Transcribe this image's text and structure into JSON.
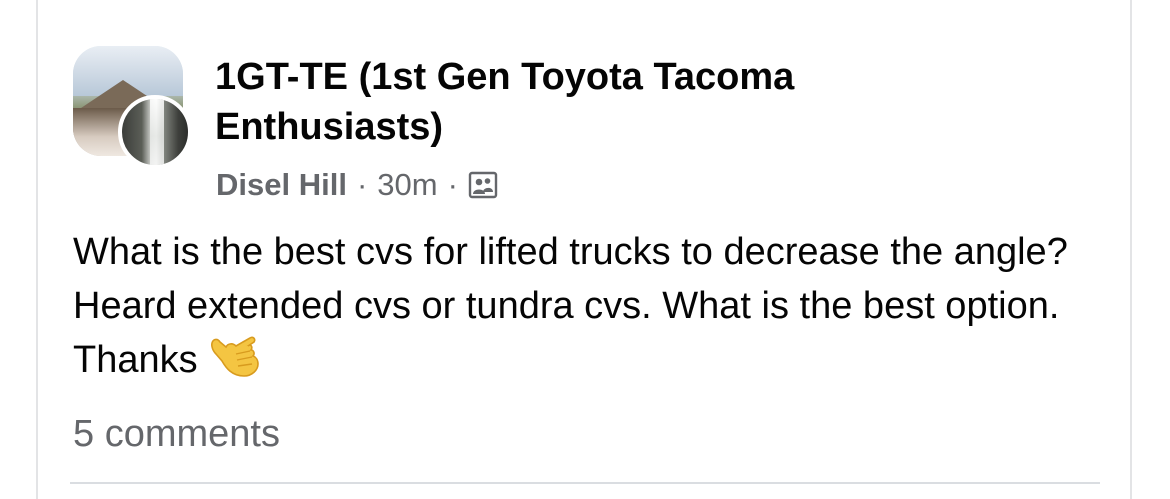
{
  "post": {
    "group_name": "1GT-TE (1st Gen Toyota Tacoma Enthusiasts)",
    "author": "Disel Hill",
    "separator": "·",
    "time": "30m",
    "audience_icon": "members-icon",
    "body": "What is the best cvs for lifted trucks to decrease the angle? Heard extended cvs or tundra cvs. What is the best option. Thanks",
    "emoji": "call-me-hand-emoji",
    "comments_count": "5 comments"
  },
  "colors": {
    "primary_text": "#050505",
    "secondary_text": "#65676b",
    "divider": "#dadde1"
  }
}
